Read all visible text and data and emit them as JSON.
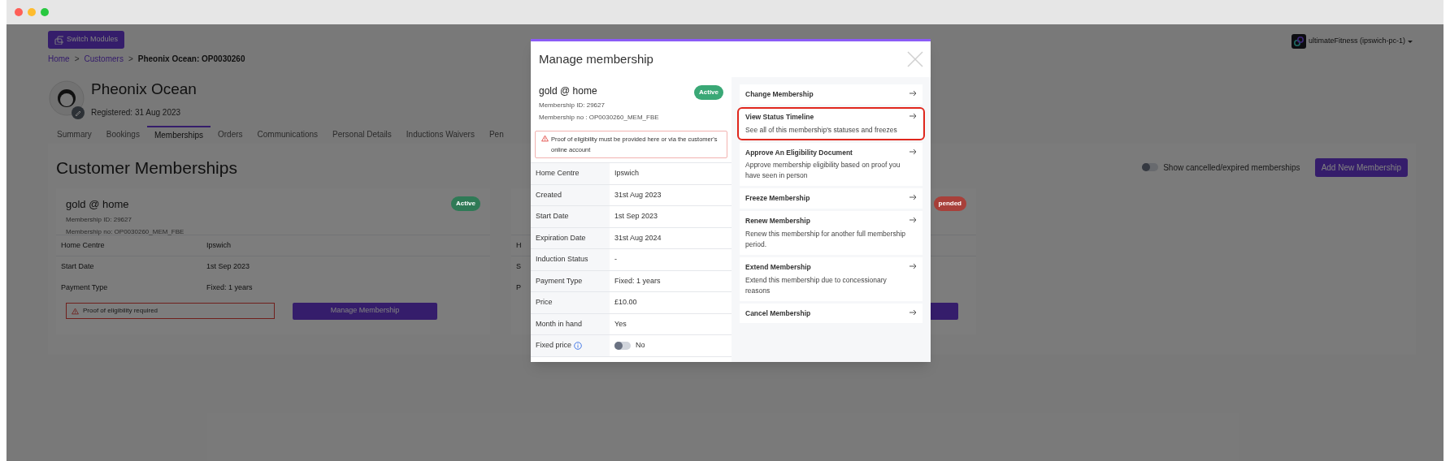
{
  "header": {
    "switch_button": "Switch Modules",
    "account": "ultimateFitness (ipswich-pc-1)"
  },
  "breadcrumb": {
    "separator": ">",
    "items": [
      {
        "label": "Home",
        "link": true
      },
      {
        "label": "Customers",
        "link": true
      },
      {
        "label": "Pheonix Ocean: OP0030260",
        "link": false
      }
    ]
  },
  "customer": {
    "name": "Pheonix Ocean",
    "registered": "Registered: 31 Aug 2023"
  },
  "tabs": [
    {
      "label": "Summary",
      "selected": false
    },
    {
      "label": "Bookings",
      "selected": false
    },
    {
      "label": "Memberships",
      "selected": true
    },
    {
      "label": "Orders",
      "selected": false
    },
    {
      "label": "Communications",
      "selected": false
    },
    {
      "label": "Personal Details",
      "selected": false
    },
    {
      "label": "Inductions Waivers",
      "selected": false
    },
    {
      "label": "Pen",
      "selected": false
    }
  ],
  "section": {
    "title": "Customer Memberships",
    "toggle_label": "Show cancelled/expired memberships",
    "toggle_on": false,
    "add_button": "Add New Membership"
  },
  "cards": [
    {
      "name": "gold @ home",
      "id_line": "Membership ID: 29627",
      "no_line": "Membership no: OP0030260_MEM_FBE",
      "status": "Active",
      "color": "#2f7a56",
      "rows": [
        {
          "label": "Home Centre",
          "value": "Ipswich"
        },
        {
          "label": "Start Date",
          "value": "1st Sep 2023"
        },
        {
          "label": "Payment Type",
          "value": "Fixed: 1 years"
        }
      ],
      "alert": "Proof of eligibility required",
      "button": "Manage Membership"
    },
    {
      "status": "pended",
      "color": "#a8403a",
      "rows": [
        {
          "label": "H"
        },
        {
          "label": "S"
        },
        {
          "label": "P"
        }
      ],
      "has_button": true
    }
  ],
  "modal": {
    "title": "Manage membership",
    "name": "gold @ home",
    "status": "Active",
    "color": "#3aa876",
    "id_line": "Membership ID: 29627",
    "no_line": "Membership no : OP0030260_MEM_FBE",
    "alert": "Proof of eligibility must be provided here or via the customer's online account",
    "details": [
      {
        "kind": "text",
        "label": "Home Centre",
        "value": "Ipswich"
      },
      {
        "kind": "text",
        "label": "Created",
        "value": "31st Aug 2023"
      },
      {
        "kind": "text",
        "label": "Start Date",
        "value": "1st Sep 2023"
      },
      {
        "kind": "text",
        "label": "Expiration Date",
        "value": "31st Aug 2024"
      },
      {
        "kind": "text",
        "label": "Induction Status",
        "value": "-"
      },
      {
        "kind": "text",
        "label": "Payment Type",
        "value": "Fixed: 1 years"
      },
      {
        "kind": "text",
        "label": "Price",
        "value": "£10.00"
      },
      {
        "kind": "text",
        "label": "Month in hand",
        "value": "Yes"
      },
      {
        "kind": "toggle",
        "label": "Fixed price",
        "info": true,
        "on": false,
        "value": "No"
      }
    ],
    "actions": [
      {
        "title": "Change Membership",
        "highlighted": false
      },
      {
        "title": "View Status Timeline",
        "description": "See all of this membership's statuses and freezes",
        "highlighted": true
      },
      {
        "title": "Approve An Eligibility Document",
        "description": "Approve membership eligibility based on proof you have seen in person",
        "highlighted": false
      },
      {
        "title": "Freeze Membership",
        "highlighted": false
      },
      {
        "title": "Renew Membership",
        "description": "Renew this membership for another full membership period.",
        "highlighted": false
      },
      {
        "title": "Extend Membership",
        "description": "Extend this membership due to concessionary reasons",
        "highlighted": false
      },
      {
        "title": "Cancel Membership",
        "highlighted": false
      }
    ]
  }
}
